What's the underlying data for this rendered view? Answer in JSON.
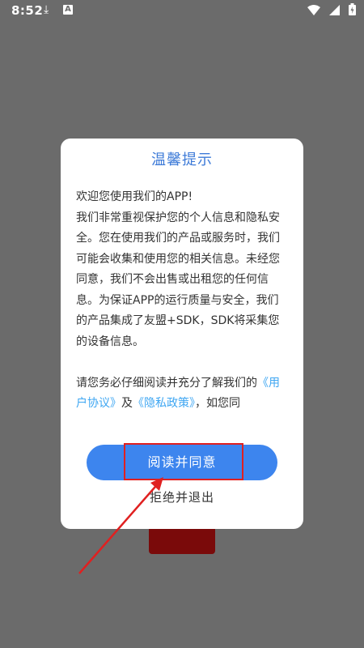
{
  "status_bar": {
    "time": "8:52",
    "download_icon": "download-icon",
    "app_icon_letter": "A",
    "wifi_icon": "wifi-icon",
    "signal_icon": "signal-icon",
    "battery_icon": "battery-charging-icon"
  },
  "dialog": {
    "title": "温馨提示",
    "paragraphs": [
      "欢迎您使用我们的APP!",
      "我们非常重视保护您的个人信息和隐私安全。您在使用我们的产品或服务时，我们可能会收集和使用您的相关信息。未经您同意，我们不会出售或出租您的任何信息。为保证APP的运行质量与安全，我们的产品集成了友盟+SDK，SDK将采集您的设备信息。",
      "请您务必仔细阅读并充分了解我们的"
    ],
    "user_agreement_link": "《用户协议》",
    "and_text": "及",
    "privacy_policy_link": "《隐私政策》",
    "tail_text": "，如您同",
    "agree_button": "阅读并同意",
    "refuse_button": "拒绝并退出"
  },
  "colors": {
    "accent": "#3e7bd8",
    "button": "#3d85ee",
    "link": "#3ea6f2",
    "annotation": "#e02020",
    "overlay": "#6b6b6b"
  }
}
